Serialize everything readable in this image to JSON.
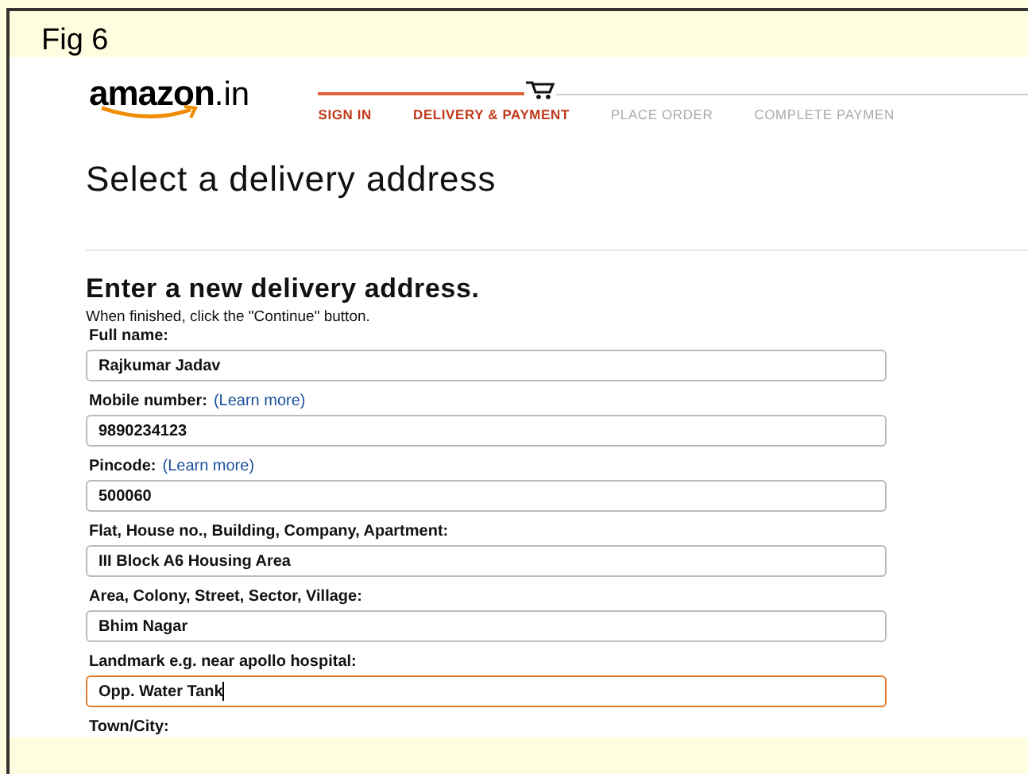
{
  "slide": {
    "caption": "Fig 6"
  },
  "header": {
    "logo": {
      "name": "amazon",
      "suffix": ".in"
    },
    "steps": [
      {
        "label": "SIGN IN",
        "active": true
      },
      {
        "label": "DELIVERY & PAYMENT",
        "active": true
      },
      {
        "label": "PLACE ORDER",
        "active": false
      },
      {
        "label": "COMPLETE PAYMEN",
        "active": false
      }
    ]
  },
  "page_title": "Select a delivery address",
  "form": {
    "heading": "Enter a new delivery address.",
    "instruction": "When finished, click the \"Continue\" button.",
    "fields": [
      {
        "label": "Full name:",
        "value": "Rajkumar Jadav",
        "focused": false
      },
      {
        "label": "Mobile number:",
        "link": "(Learn more)",
        "value": "9890234123",
        "focused": false
      },
      {
        "label": "Pincode:",
        "link": "(Learn more)",
        "value": "500060",
        "focused": false
      },
      {
        "label": "Flat, House no., Building, Company, Apartment:",
        "value": "III Block A6 Housing Area",
        "focused": false
      },
      {
        "label": "Area, Colony, Street, Sector, Village:",
        "value": "Bhim Nagar",
        "focused": false
      },
      {
        "label": "Landmark e.g. near apollo hospital:",
        "value": "Opp. Water Tank",
        "focused": true
      },
      {
        "label": "Town/City:"
      }
    ]
  }
}
